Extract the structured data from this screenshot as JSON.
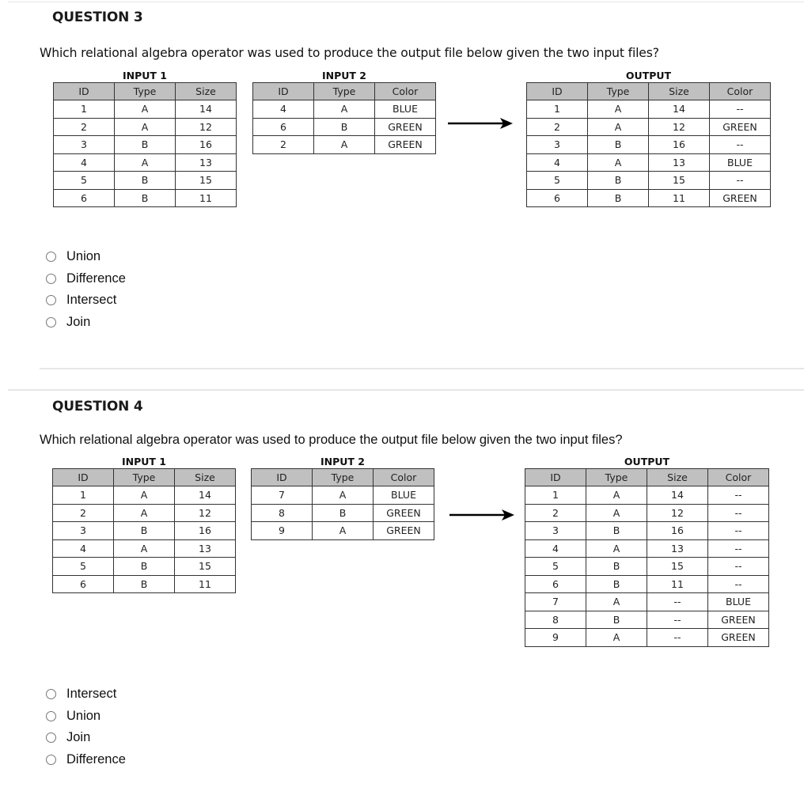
{
  "questions": [
    {
      "title": "QUESTION 3",
      "prompt": "Which relational algebra operator was used to produce the output file below given the two input files?",
      "input1": {
        "label": "INPUT 1",
        "columns": [
          "ID",
          "Type",
          "Size"
        ],
        "rows": [
          [
            "1",
            "A",
            "14"
          ],
          [
            "2",
            "A",
            "12"
          ],
          [
            "3",
            "B",
            "16"
          ],
          [
            "4",
            "A",
            "13"
          ],
          [
            "5",
            "B",
            "15"
          ],
          [
            "6",
            "B",
            "11"
          ]
        ]
      },
      "input2": {
        "label": "INPUT 2",
        "columns": [
          "ID",
          "Type",
          "Color"
        ],
        "rows": [
          [
            "4",
            "A",
            "BLUE"
          ],
          [
            "6",
            "B",
            "GREEN"
          ],
          [
            "2",
            "A",
            "GREEN"
          ]
        ]
      },
      "output": {
        "label": "OUTPUT",
        "columns": [
          "ID",
          "Type",
          "Size",
          "Color"
        ],
        "rows": [
          [
            "1",
            "A",
            "14",
            "--"
          ],
          [
            "2",
            "A",
            "12",
            "GREEN"
          ],
          [
            "3",
            "B",
            "16",
            "--"
          ],
          [
            "4",
            "A",
            "13",
            "BLUE"
          ],
          [
            "5",
            "B",
            "15",
            "--"
          ],
          [
            "6",
            "B",
            "11",
            "GREEN"
          ]
        ]
      },
      "options": [
        "Union",
        "Difference",
        "Intersect",
        "Join"
      ]
    },
    {
      "title": "QUESTION 4",
      "prompt": "Which relational algebra operator was used to produce the output file below given the two input files?",
      "input1": {
        "label": "INPUT 1",
        "columns": [
          "ID",
          "Type",
          "Size"
        ],
        "rows": [
          [
            "1",
            "A",
            "14"
          ],
          [
            "2",
            "A",
            "12"
          ],
          [
            "3",
            "B",
            "16"
          ],
          [
            "4",
            "A",
            "13"
          ],
          [
            "5",
            "B",
            "15"
          ],
          [
            "6",
            "B",
            "11"
          ]
        ]
      },
      "input2": {
        "label": "INPUT 2",
        "columns": [
          "ID",
          "Type",
          "Color"
        ],
        "rows": [
          [
            "7",
            "A",
            "BLUE"
          ],
          [
            "8",
            "B",
            "GREEN"
          ],
          [
            "9",
            "A",
            "GREEN"
          ]
        ]
      },
      "output": {
        "label": "OUTPUT",
        "columns": [
          "ID",
          "Type",
          "Size",
          "Color"
        ],
        "rows": [
          [
            "1",
            "A",
            "14",
            "--"
          ],
          [
            "2",
            "A",
            "12",
            "--"
          ],
          [
            "3",
            "B",
            "16",
            "--"
          ],
          [
            "4",
            "A",
            "13",
            "--"
          ],
          [
            "5",
            "B",
            "15",
            "--"
          ],
          [
            "6",
            "B",
            "11",
            "--"
          ],
          [
            "7",
            "A",
            "--",
            "BLUE"
          ],
          [
            "8",
            "B",
            "--",
            "GREEN"
          ],
          [
            "9",
            "A",
            "--",
            "GREEN"
          ]
        ]
      },
      "options": [
        "Intersect",
        "Union",
        "Join",
        "Difference"
      ]
    }
  ]
}
